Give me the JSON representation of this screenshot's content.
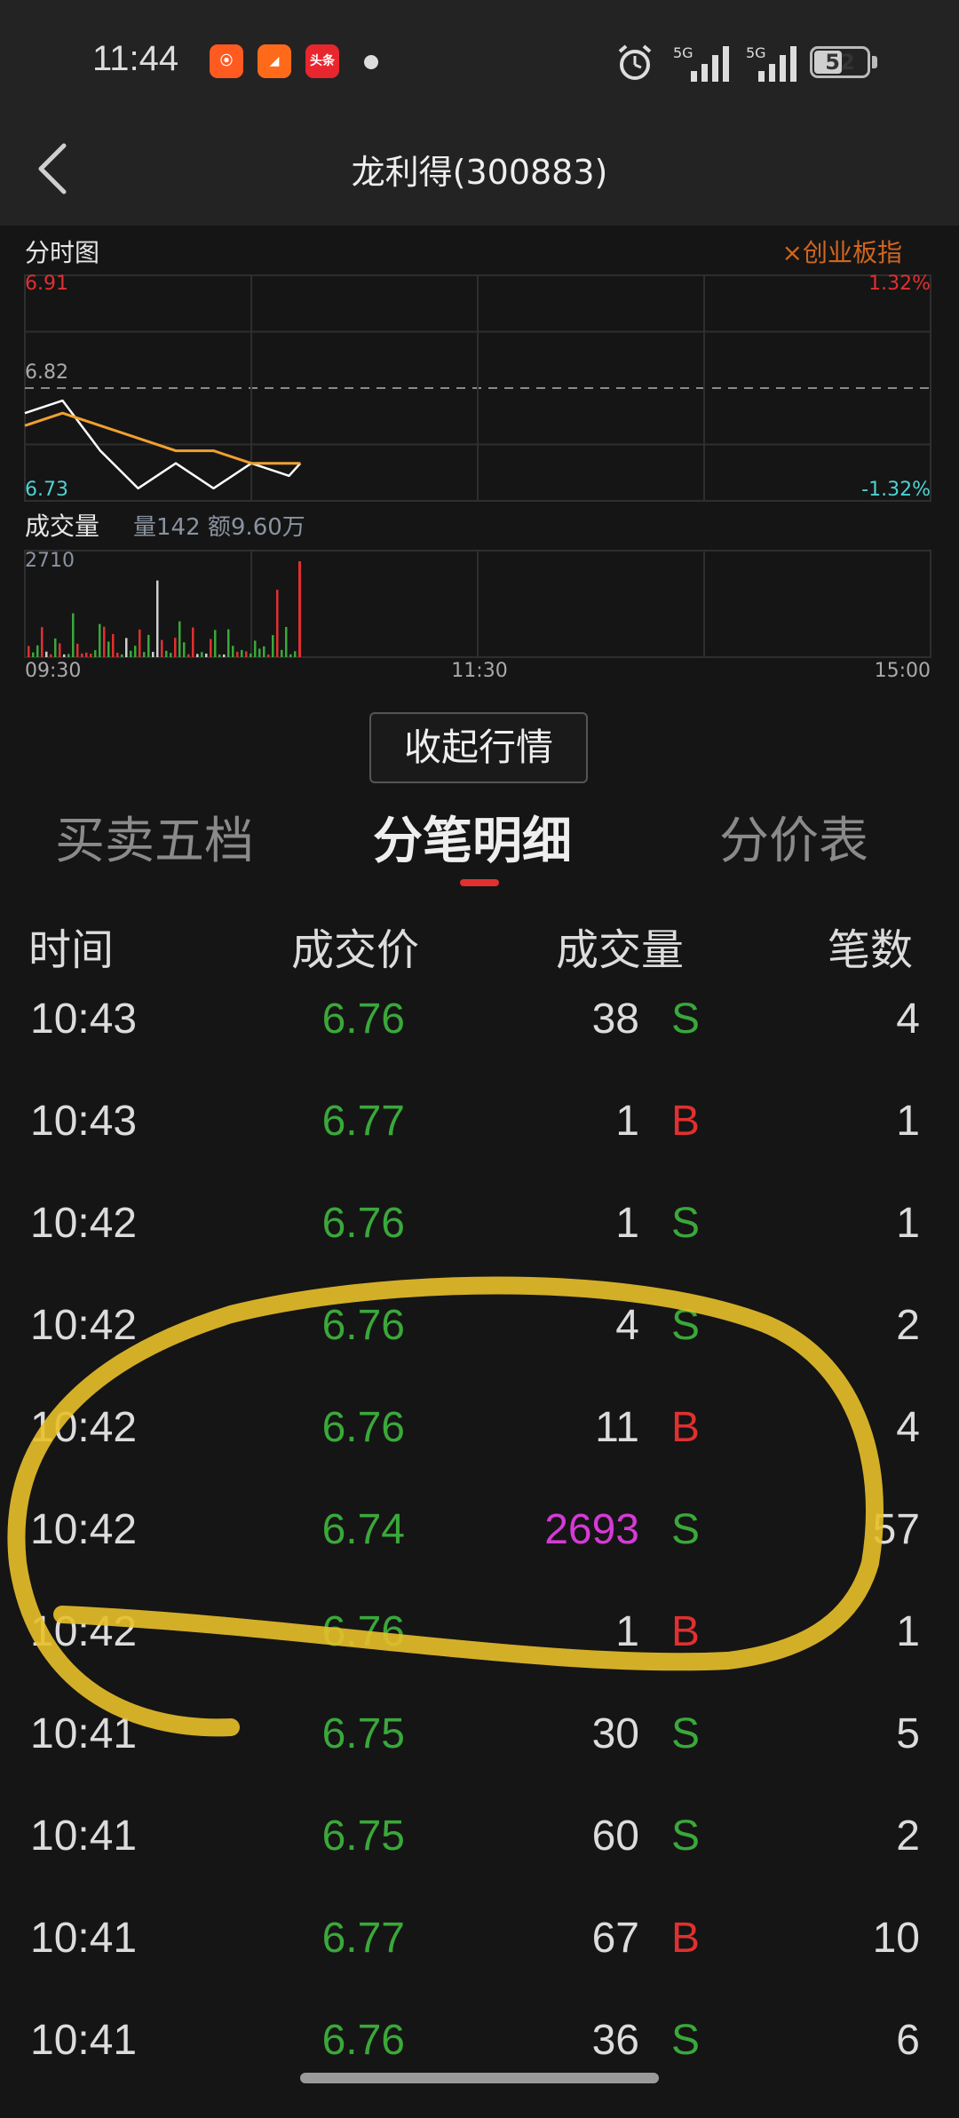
{
  "status_bar": {
    "time": "11:44",
    "app_icons": [
      {
        "name": "kuaishou-icon",
        "color": "#ff5a1f",
        "glyph": "⦿"
      },
      {
        "name": "message-app-icon",
        "color": "#ff6a1a",
        "glyph": "◢"
      },
      {
        "name": "toutiao-icon",
        "color": "#e8262e",
        "glyph": "头条"
      }
    ],
    "signal_1": "5G",
    "signal_2": "5G",
    "battery": "52"
  },
  "header": {
    "title": "龙利得(300883)"
  },
  "chart": {
    "section_label": "分时图",
    "compare_label": "×创业板指",
    "price_high": "6.91",
    "price_mid": "6.82",
    "price_low": "6.73",
    "pct_high": "1.32%",
    "pct_low": "-1.32%",
    "volume_label": "成交量",
    "volume_info": "量142  额9.60万",
    "volume_max": "2710",
    "time_start": "09:30",
    "time_mid": "11:30",
    "time_end": "15:00",
    "colors": {
      "up": "#e03030",
      "down": "#3aa83a",
      "price_line": "#ffffff",
      "avg_line": "#f0a030",
      "index_line": "#d0661e"
    }
  },
  "chart_data": {
    "type": "line",
    "x": [
      "09:30",
      "09:40",
      "09:50",
      "10:00",
      "10:10",
      "10:20",
      "10:30",
      "10:40",
      "10:43"
    ],
    "series": [
      {
        "values": [
          6.8,
          6.81,
          6.77,
          6.74,
          6.76,
          6.74,
          6.76,
          6.75,
          6.76
        ]
      },
      {
        "values": [
          6.79,
          6.8,
          6.79,
          6.78,
          6.77,
          6.77,
          6.76,
          6.76,
          6.76
        ]
      }
    ],
    "ylim": [
      6.73,
      6.91
    ],
    "volume_ylim": [
      0,
      2710
    ]
  },
  "toggle": {
    "label": "收起行情"
  },
  "tabs": [
    {
      "label": "买卖五档"
    },
    {
      "label": "分笔明细"
    },
    {
      "label": "分价表"
    }
  ],
  "table": {
    "headers": [
      "时间",
      "成交价",
      "成交量",
      "笔数"
    ],
    "rows": [
      {
        "time": "10:43",
        "price": "6.76",
        "volume": "38",
        "side": "S",
        "count": "4"
      },
      {
        "time": "10:43",
        "price": "6.77",
        "volume": "1",
        "side": "B",
        "count": "1"
      },
      {
        "time": "10:42",
        "price": "6.76",
        "volume": "1",
        "side": "S",
        "count": "1"
      },
      {
        "time": "10:42",
        "price": "6.76",
        "volume": "4",
        "side": "S",
        "count": "2"
      },
      {
        "time": "10:42",
        "price": "6.76",
        "volume": "11",
        "side": "B",
        "count": "4"
      },
      {
        "time": "10:42",
        "price": "6.74",
        "volume": "2693",
        "side": "S",
        "count": "57"
      },
      {
        "time": "10:42",
        "price": "6.76",
        "volume": "1",
        "side": "B",
        "count": "1"
      },
      {
        "time": "10:41",
        "price": "6.75",
        "volume": "30",
        "side": "S",
        "count": "5"
      },
      {
        "time": "10:41",
        "price": "6.75",
        "volume": "60",
        "side": "S",
        "count": "2"
      },
      {
        "time": "10:41",
        "price": "6.77",
        "volume": "67",
        "side": "B",
        "count": "10"
      },
      {
        "time": "10:41",
        "price": "6.76",
        "volume": "36",
        "side": "S",
        "count": "6"
      }
    ],
    "colors": {
      "buy": "#e03030",
      "sell": "#3aa83a",
      "large_volume": "#d63ad6"
    }
  }
}
